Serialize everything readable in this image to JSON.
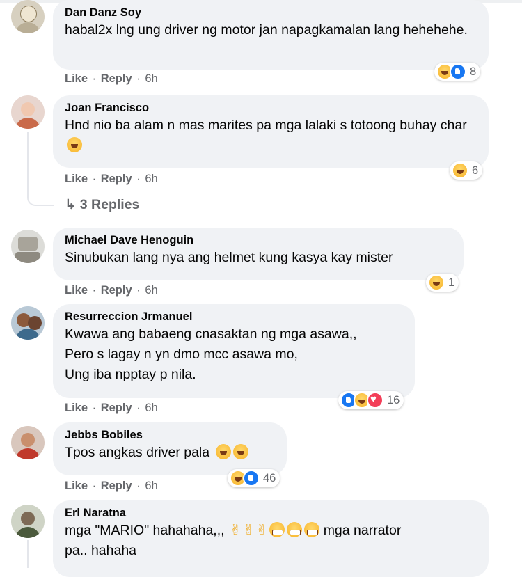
{
  "comments": [
    {
      "name": "Dan Danz Soy",
      "text": "habal2x lng ung driver ng motor jan napagkamalan lang hehehehe.",
      "actions": {
        "like": "Like",
        "reply": "Reply",
        "time": "6h"
      },
      "reactions": {
        "icons": [
          "haha-icon",
          "like-icon"
        ],
        "count": "8"
      }
    },
    {
      "name": "Joan Francisco",
      "text": "Hnd nio ba alam n mas marites pa mga lalaki s totoong buhay char",
      "actions": {
        "like": "Like",
        "reply": "Reply",
        "time": "6h"
      },
      "reactions": {
        "icons": [
          "haha-icon"
        ],
        "count": "6"
      },
      "replies_label": "3 Replies"
    },
    {
      "name": "Michael Dave Henoguin",
      "text": "Sinubukan lang nya ang helmet kung kasya kay mister",
      "actions": {
        "like": "Like",
        "reply": "Reply",
        "time": "6h"
      },
      "reactions": {
        "icons": [
          "haha-icon"
        ],
        "count": "1"
      }
    },
    {
      "name": "Resurreccion Jrmanuel",
      "text": "Kwawa ang babaeng cnasaktan ng mga asawa,,\nPero s lagay n yn dmo mcc asawa mo,\nUng iba npptay p nila.",
      "actions": {
        "like": "Like",
        "reply": "Reply",
        "time": "6h"
      },
      "reactions": {
        "icons": [
          "like-icon",
          "haha-icon",
          "love-icon"
        ],
        "count": "16"
      }
    },
    {
      "name": "Jebbs Bobiles",
      "text": "Tpos angkas driver pala",
      "actions": {
        "like": "Like",
        "reply": "Reply",
        "time": "6h"
      },
      "reactions": {
        "icons": [
          "haha-icon",
          "like-icon"
        ],
        "count": "46"
      }
    },
    {
      "name": "Erl Naratna",
      "text_before": "mga \"MARIO\" hahahaha,,,",
      "text_after": "mga narrator",
      "text_line2": "pa.. hahaha"
    }
  ],
  "colors": {
    "bubble": "#f0f2f5",
    "meta": "#65676b",
    "like_blue": "#1877f2",
    "love_red": "#f33e58",
    "haha_yellow": "#f7b125"
  }
}
